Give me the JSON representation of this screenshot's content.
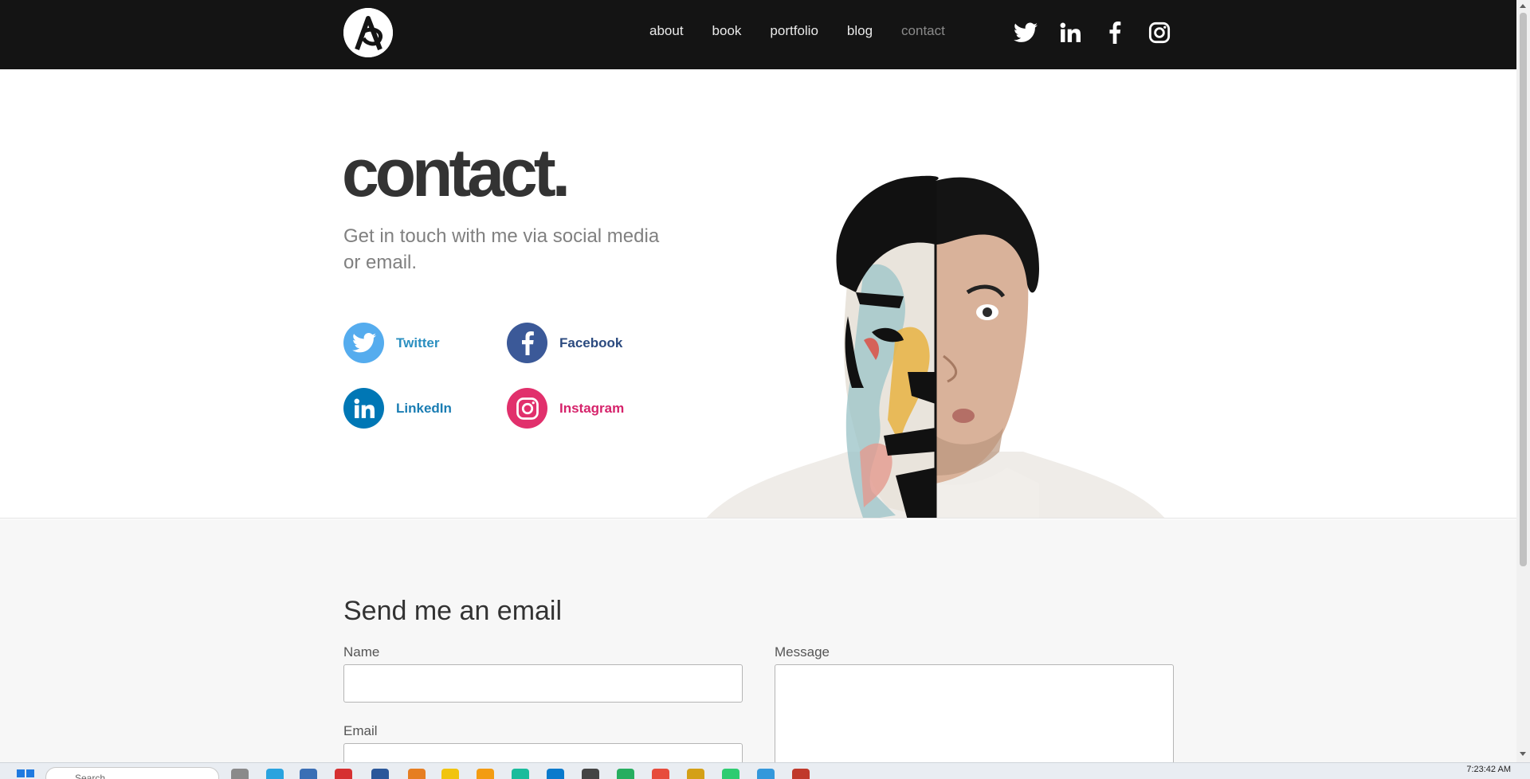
{
  "nav": {
    "links": [
      "about",
      "book",
      "portfolio",
      "blog",
      "contact"
    ],
    "active": "contact",
    "social_icons": [
      "twitter-icon",
      "linkedin-icon",
      "facebook-icon",
      "instagram-icon"
    ]
  },
  "hero": {
    "title": "contact.",
    "subtitle": "Get in touch with me via social media or email.",
    "links": [
      {
        "label": "Twitter",
        "icon": "twitter-icon",
        "color": "#55acee"
      },
      {
        "label": "Facebook",
        "icon": "facebook-icon",
        "color": "#3b5998"
      },
      {
        "label": "LinkedIn",
        "icon": "linkedin-icon",
        "color": "#0077b5"
      },
      {
        "label": "Instagram",
        "icon": "instagram-icon",
        "color": "#e1306c"
      }
    ],
    "label_colors": {
      "twitter": "#2b8fc0",
      "facebook": "#2b4a7f",
      "linkedin": "#1a7db3",
      "instagram": "#d6236b"
    }
  },
  "form": {
    "heading": "Send me an email",
    "name_label": "Name",
    "email_label": "Email",
    "message_label": "Message",
    "name_value": "",
    "email_value": "",
    "message_value": ""
  },
  "taskbar": {
    "search_placeholder": "Search",
    "clock": "7:23:42 AM"
  },
  "colors": {
    "topbar": "#141414",
    "title": "#333333",
    "subtitle": "#808080",
    "form_bg": "#f7f7f7"
  }
}
